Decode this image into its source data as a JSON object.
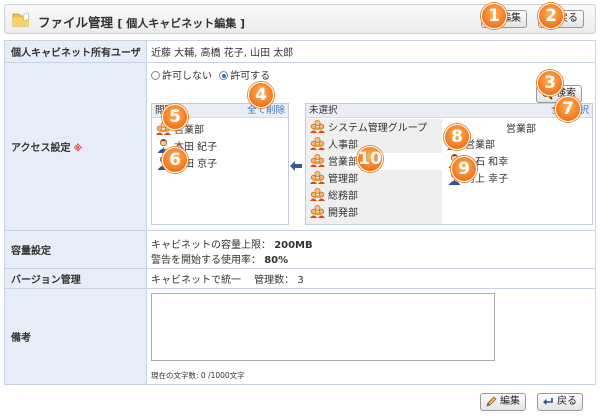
{
  "header": {
    "title": "ファイル管理",
    "subtitle": "[ 個人キャビネット編集 ]",
    "edit_label": "編集",
    "back_label": "戻る"
  },
  "badges": [
    "1",
    "2",
    "3",
    "4",
    "5",
    "6",
    "7",
    "8",
    "9",
    "10"
  ],
  "owners": {
    "label": "個人キャビネット所有ユーザ",
    "value": "近藤 大輔, 高橋 花子, 山田 太郎"
  },
  "access": {
    "label": "アクセス設定",
    "required_mark": "※",
    "option_deny": "許可しない",
    "option_allow": "許可する",
    "selected": "allow",
    "search_label": "検索",
    "view_box": {
      "title": "閲覧",
      "remove_all": "全て削除",
      "items": [
        {
          "type": "group",
          "name": "営業部"
        },
        {
          "type": "user",
          "name": "本田 紀子"
        },
        {
          "type": "user",
          "name": "山田 京子"
        }
      ]
    },
    "unselected_box": {
      "title": "未選択",
      "select_all": "全て選択",
      "groups": [
        {
          "name": "システム管理グループ"
        },
        {
          "name": "人事部"
        },
        {
          "name": "営業部"
        },
        {
          "name": "管理部"
        },
        {
          "name": "総務部"
        },
        {
          "name": "開発部"
        }
      ],
      "selected_group_heading": "営業部",
      "members": [
        {
          "type": "group",
          "name": "営業部"
        },
        {
          "type": "user",
          "name": "大石 和幸"
        },
        {
          "type": "user",
          "name": "村上 幸子"
        }
      ]
    }
  },
  "capacity": {
    "label": "容量設定",
    "limit_label": "キャビネットの容量上限：",
    "limit_value": "200MB",
    "warn_label": "警告を開始する使用率：",
    "warn_value": "80%"
  },
  "version": {
    "label": "バージョン管理",
    "value": "キャビネットで統一　 管理数： 3"
  },
  "memo": {
    "label": "備考",
    "value": "",
    "counter": "現在の文字数: 0 /1000文字"
  },
  "colors": {
    "label_bg": "#e6edf6",
    "border": "#c8d4e4",
    "link": "#3a70c8",
    "badge": "#f0741b"
  }
}
